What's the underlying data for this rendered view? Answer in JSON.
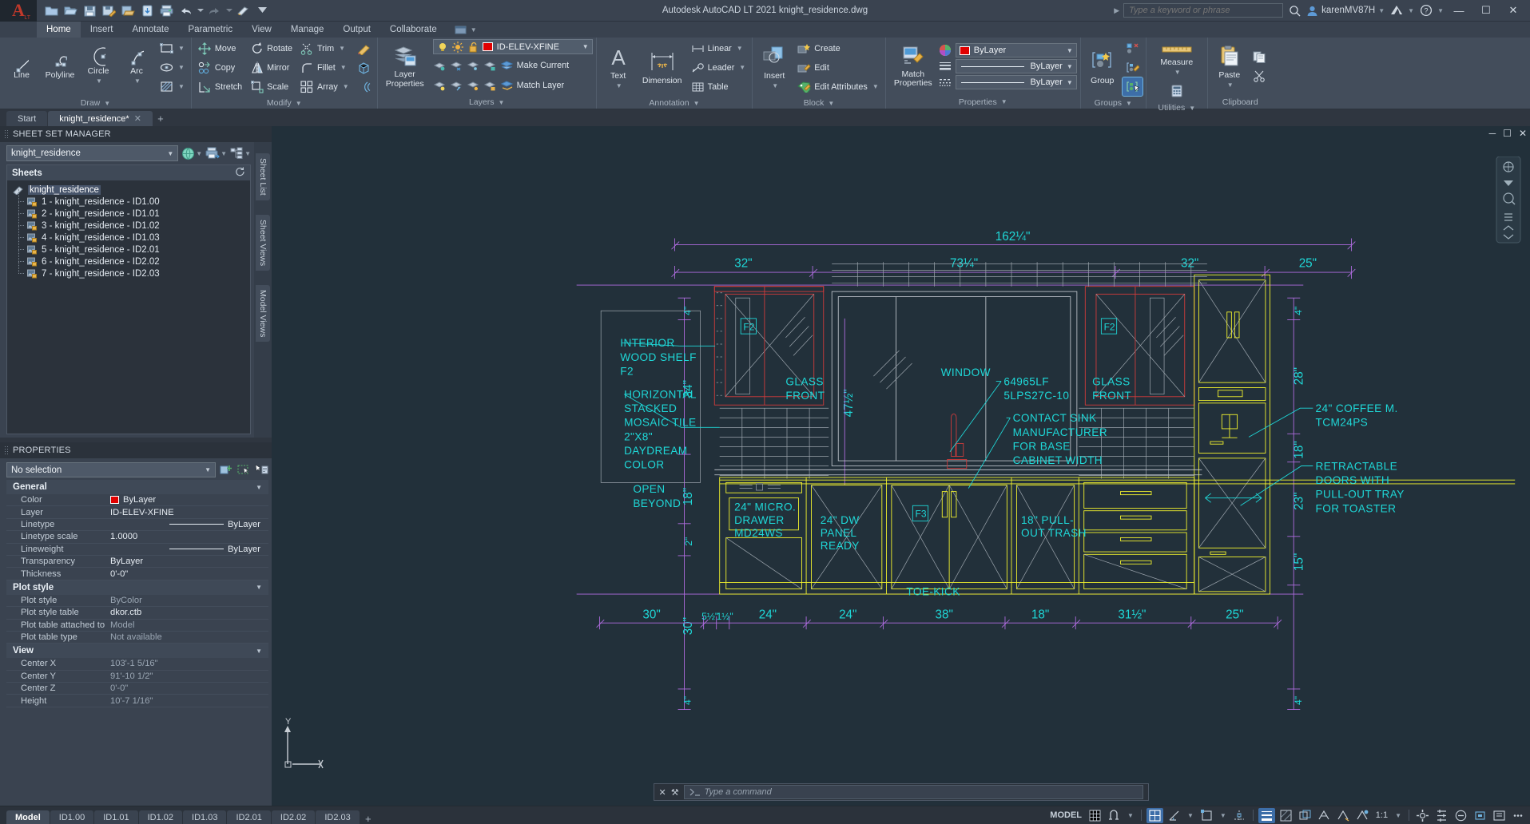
{
  "app": {
    "title": "Autodesk AutoCAD LT 2021    knight_residence.dwg",
    "logo_letter": "A",
    "logo_sub": "LT"
  },
  "quick_access": [
    {
      "name": "new-icon",
      "label": "New"
    },
    {
      "name": "open-icon",
      "label": "Open"
    },
    {
      "name": "save-icon",
      "label": "Save"
    },
    {
      "name": "save-as-icon",
      "label": "Save As"
    },
    {
      "name": "open-from-web-icon",
      "label": "Open from Web & Mobile"
    },
    {
      "name": "save-to-web-icon",
      "label": "Save to Web & Mobile"
    },
    {
      "name": "plot-icon",
      "label": "Plot"
    },
    {
      "name": "undo-icon",
      "label": "Undo"
    },
    {
      "name": "redo-icon",
      "label": "Redo"
    },
    {
      "name": "customize-icon",
      "label": "Customize Quick Access Toolbar"
    }
  ],
  "search": {
    "placeholder": "Type a keyword or phrase",
    "icon": "search-icon"
  },
  "account": {
    "user": "karenMV87H",
    "autodesk_icon": "autodesk-app-icon",
    "help_icon": "help-icon"
  },
  "window_controls": {
    "minimize": "—",
    "maximize": "☐",
    "close": "✕"
  },
  "ribbon_tabs": [
    {
      "label": "Home",
      "active": true
    },
    {
      "label": "Insert",
      "active": false
    },
    {
      "label": "Annotate",
      "active": false
    },
    {
      "label": "Parametric",
      "active": false
    },
    {
      "label": "View",
      "active": false
    },
    {
      "label": "Manage",
      "active": false
    },
    {
      "label": "Output",
      "active": false
    },
    {
      "label": "Collaborate",
      "active": false
    }
  ],
  "ribbon": {
    "draw": {
      "title": "Draw",
      "big": [
        {
          "label": "Line",
          "icon": "line-icon"
        },
        {
          "label": "Polyline",
          "icon": "polyline-icon"
        },
        {
          "label": "Circle",
          "icon": "circle-icon",
          "dropdown": true
        },
        {
          "label": "Arc",
          "icon": "arc-icon",
          "dropdown": true
        }
      ],
      "small": [
        {
          "label": "",
          "icon": "rectangle-icon",
          "dropdown": true
        },
        {
          "label": "",
          "icon": "ellipse-icon",
          "dropdown": true
        },
        {
          "label": "",
          "icon": "hatch-icon",
          "dropdown": true
        }
      ]
    },
    "modify": {
      "title": "Modify",
      "items": [
        {
          "label": "Move",
          "icon": "move-icon"
        },
        {
          "label": "Rotate",
          "icon": "rotate-icon"
        },
        {
          "label": "Trim",
          "icon": "trim-icon",
          "dropdown": true
        },
        {
          "label": "Copy",
          "icon": "copy-icon"
        },
        {
          "label": "Mirror",
          "icon": "mirror-icon"
        },
        {
          "label": "Fillet",
          "icon": "fillet-icon",
          "dropdown": true
        },
        {
          "label": "Stretch",
          "icon": "stretch-icon"
        },
        {
          "label": "Scale",
          "icon": "scale-icon"
        },
        {
          "label": "Array",
          "icon": "array-icon",
          "dropdown": true
        }
      ],
      "extra": [
        {
          "label": "",
          "icon": "erase-icon"
        },
        {
          "label": "",
          "icon": "explode-icon"
        },
        {
          "label": "",
          "icon": "offset-icon"
        }
      ]
    },
    "layers": {
      "title": "Layers",
      "big_label_line1": "Layer",
      "big_label_line2": "Properties",
      "big_icon": "layer-properties-icon",
      "current_layer": "ID-ELEV-XFINE",
      "layer_color": "#e10000",
      "state_icons": [
        "lightbulb-icon",
        "sun-icon",
        "unlock-icon"
      ],
      "row_icons_1": [
        "layer-isolate-icon",
        "layer-freeze-icon",
        "layer-off-icon",
        "layer-lock-icon"
      ],
      "row_icons_2": [
        "layer-unisolate-icon",
        "layer-thaw-icon",
        "layer-on-icon",
        "layer-unlock-icon"
      ],
      "make_current": "Make Current",
      "match_layer": "Match Layer"
    },
    "annotation": {
      "title": "Annotation",
      "text": "Text",
      "text_icon": "text-icon",
      "dimension": "Dimension",
      "dimension_icon": "dimension-icon",
      "linear": "Linear",
      "linear_icon": "linear-dim-icon",
      "leader": "Leader",
      "leader_icon": "leader-icon",
      "table": "Table",
      "table_icon": "table-icon"
    },
    "block": {
      "title": "Block",
      "insert": "Insert",
      "insert_icon": "insert-block-icon",
      "create": "Create",
      "create_icon": "create-block-icon",
      "edit": "Edit",
      "edit_icon": "edit-block-icon",
      "edit_attributes": "Edit Attributes",
      "edit_attributes_icon": "edit-attributes-icon"
    },
    "properties": {
      "title": "Properties",
      "match_line1": "Match",
      "match_line2": "Properties",
      "match_icon": "match-properties-icon",
      "color_icon": "color-wheel-icon",
      "lineweight_icon": "lineweight-icon",
      "linetype_icon": "linetype-icon",
      "color_value": "ByLayer",
      "lineweight_value": "ByLayer",
      "linetype_value": "ByLayer",
      "color_swatch": "#e10000"
    },
    "groups": {
      "title": "Groups",
      "group": "Group",
      "group_icon": "group-icon",
      "ungroup_icon": "ungroup-icon",
      "group_edit_icon": "group-edit-icon",
      "group_selection_icon": "group-selection-on-icon"
    },
    "utilities": {
      "title": "Utilities",
      "measure": "Measure",
      "measure_icon": "measure-ruler-icon",
      "quick_calc_icon": "quick-calc-icon"
    },
    "clipboard": {
      "title": "Clipboard",
      "paste": "Paste",
      "paste_icon": "paste-icon",
      "copy_clip_icon": "copy-clip-icon",
      "cut_clip_icon": "cut-clip-icon"
    }
  },
  "doc_tabs": [
    {
      "label": "Start",
      "active": false,
      "closable": false
    },
    {
      "label": "knight_residence*",
      "active": true,
      "closable": true
    }
  ],
  "sheet_set_manager": {
    "title": "SHEET SET MANAGER",
    "combo_value": "knight_residence",
    "toolbar_icons": [
      "sheet-set-globe-icon",
      "publish-icon",
      "sheet-tree-icon"
    ],
    "tree_header": "Sheets",
    "refresh_icon": "refresh-icon",
    "root": "knight_residence",
    "sheets": [
      "1 - knight_residence - ID1.00",
      "2 - knight_residence - ID1.01",
      "3 - knight_residence - ID1.02",
      "4 - knight_residence - ID1.03",
      "5 - knight_residence - ID2.01",
      "6 - knight_residence - ID2.02",
      "7 - knight_residence - ID2.03"
    ],
    "side_tabs": [
      "Sheet List",
      "Sheet Views",
      "Model Views"
    ]
  },
  "properties_palette": {
    "title": "PROPERTIES",
    "selection": "No selection",
    "tool_icons": [
      "quick-select-icon",
      "select-objects-icon",
      "quick-properties-icon"
    ],
    "groups": [
      {
        "name": "General",
        "rows": [
          {
            "key": "Color",
            "value": "ByLayer",
            "swatch": "#e10000",
            "dim": false
          },
          {
            "key": "Layer",
            "value": "ID-ELEV-XFINE",
            "dim": false
          },
          {
            "key": "Linetype",
            "value": "ByLayer",
            "line": true,
            "dim": false
          },
          {
            "key": "Linetype scale",
            "value": "1.0000",
            "dim": false
          },
          {
            "key": "Lineweight",
            "value": "ByLayer",
            "line": true,
            "dim": false
          },
          {
            "key": "Transparency",
            "value": "ByLayer",
            "dim": false
          },
          {
            "key": "Thickness",
            "value": "0'-0\"",
            "dim": false
          }
        ]
      },
      {
        "name": "Plot style",
        "rows": [
          {
            "key": "Plot style",
            "value": "ByColor",
            "dim": true
          },
          {
            "key": "Plot style table",
            "value": "dkor.ctb",
            "dim": false
          },
          {
            "key": "Plot table attached to",
            "value": "Model",
            "dim": true
          },
          {
            "key": "Plot table type",
            "value": "Not available",
            "dim": true
          }
        ]
      },
      {
        "name": "View",
        "rows": [
          {
            "key": "Center X",
            "value": "103'-1 5/16\"",
            "dim": true
          },
          {
            "key": "Center Y",
            "value": "91'-10 1/2\"",
            "dim": true
          },
          {
            "key": "Center Z",
            "value": "0'-0\"",
            "dim": true
          },
          {
            "key": "Height",
            "value": "10'-7 1/16\"",
            "dim": true
          }
        ]
      }
    ]
  },
  "drawing": {
    "colors": {
      "background": "#22303a",
      "cyan": "#1fd7d7",
      "yellow": "#f5f52e",
      "red": "#d33b3b",
      "white": "#d8dde3",
      "magenta": "#b06ce0",
      "grey": "#9aa3ab"
    },
    "top_dimension": "162¼\"",
    "top_chain": [
      "32\"",
      "73¼\"",
      "32\"",
      "25\""
    ],
    "bottom_chain": [
      "30\"",
      "5½\"",
      "1½\"",
      "24\"",
      "24\"",
      "38\"",
      "18\"",
      "31½\"",
      "25\""
    ],
    "left_chain": [
      "4\"",
      "34\"",
      "18\"",
      "2\"",
      "30\"",
      "4\""
    ],
    "left_mid_dim": "47½\"",
    "right_chain": [
      "4\"",
      "28\"",
      "18\"",
      "23\"",
      "15\"",
      "4\""
    ],
    "annotations": [
      {
        "id": "ann-interior-wood-shelf",
        "lines": [
          "INTERIOR",
          "WOOD SHELF",
          "F2"
        ]
      },
      {
        "id": "ann-mosaic-tile",
        "lines": [
          "HORIZONTAL",
          "STACKED",
          "MOSAIC TILE",
          "2\"X8\"",
          "DAYDREAM",
          "COLOR"
        ]
      },
      {
        "id": "ann-open-beyond",
        "lines": [
          "OPEN",
          "BEYOND"
        ]
      },
      {
        "id": "ann-glass-front-left",
        "lines": [
          "GLASS",
          "FRONT"
        ]
      },
      {
        "id": "ann-glass-front-right",
        "lines": [
          "GLASS",
          "FRONT"
        ]
      },
      {
        "id": "ann-window",
        "lines": [
          "WINDOW"
        ]
      },
      {
        "id": "ann-lf-tag",
        "lines": [
          "64965LF",
          "5LPS27C-10"
        ]
      },
      {
        "id": "ann-contact-sink",
        "lines": [
          "CONTACT SINK",
          "MANUFACTURER",
          "FOR BASE",
          "CABINET WIDTH"
        ]
      },
      {
        "id": "ann-coffee-maker",
        "lines": [
          "24\" COFFEE M.",
          "TCM24PS"
        ]
      },
      {
        "id": "ann-retractable-doors",
        "lines": [
          "RETRACTABLE",
          "DOORS WITH",
          "PULL-OUT TRAY",
          "FOR TOASTER"
        ]
      },
      {
        "id": "ann-micro-drawer",
        "lines": [
          "24\" MICRO.",
          "DRAWER",
          "MD24WS"
        ]
      },
      {
        "id": "ann-dw-panel",
        "lines": [
          "24\" DW",
          "PANEL",
          "READY"
        ]
      },
      {
        "id": "ann-pull-out-trash",
        "lines": [
          "18\" PULL-",
          "OUT TRASH"
        ]
      },
      {
        "id": "ann-toe-kick",
        "lines": [
          "TOE-KICK"
        ]
      }
    ],
    "tags": [
      "F2",
      "F2",
      "F3"
    ],
    "viewport_controls": [
      "minimize-viewport-icon",
      "maximize-viewport-icon",
      "close-viewport-icon"
    ]
  },
  "command_line": {
    "placeholder": "Type a command",
    "close_icon": "close-icon",
    "options_icon": "wrench-icon",
    "prompt_icon": "command-prompt-icon"
  },
  "layout_tabs": [
    {
      "label": "Model",
      "active": true
    },
    {
      "label": "ID1.00",
      "active": false
    },
    {
      "label": "ID1.01",
      "active": false
    },
    {
      "label": "ID1.02",
      "active": false
    },
    {
      "label": "ID1.03",
      "active": false
    },
    {
      "label": "ID2.01",
      "active": false
    },
    {
      "label": "ID2.02",
      "active": false
    },
    {
      "label": "ID2.03",
      "active": false
    }
  ],
  "status_bar": {
    "space_label": "MODEL",
    "scale": "1:1",
    "icons": [
      {
        "name": "grid-display-icon",
        "on": false
      },
      {
        "name": "snap-mode-icon",
        "on": false
      },
      {
        "name": "ortho-mode-icon",
        "on": true
      },
      {
        "name": "polar-tracking-icon",
        "on": false
      },
      {
        "name": "object-snap-icon",
        "on": false
      },
      {
        "name": "object-snap-tracking-icon",
        "on": false
      },
      {
        "name": "lineweight-display-icon",
        "on": true
      },
      {
        "name": "transparency-display-icon",
        "on": false
      },
      {
        "name": "selection-cycling-icon",
        "on": false
      },
      {
        "name": "annotation-visibility-icon",
        "on": false
      },
      {
        "name": "autoscale-icon",
        "on": false
      },
      {
        "name": "annotation-scale-icon",
        "on": false
      },
      {
        "name": "workspace-switch-icon",
        "on": false
      },
      {
        "name": "customization-icon",
        "on": false
      },
      {
        "name": "isolate-objects-icon",
        "on": false
      },
      {
        "name": "hardware-accel-icon",
        "on": false
      },
      {
        "name": "clean-screen-icon",
        "on": false
      }
    ]
  }
}
